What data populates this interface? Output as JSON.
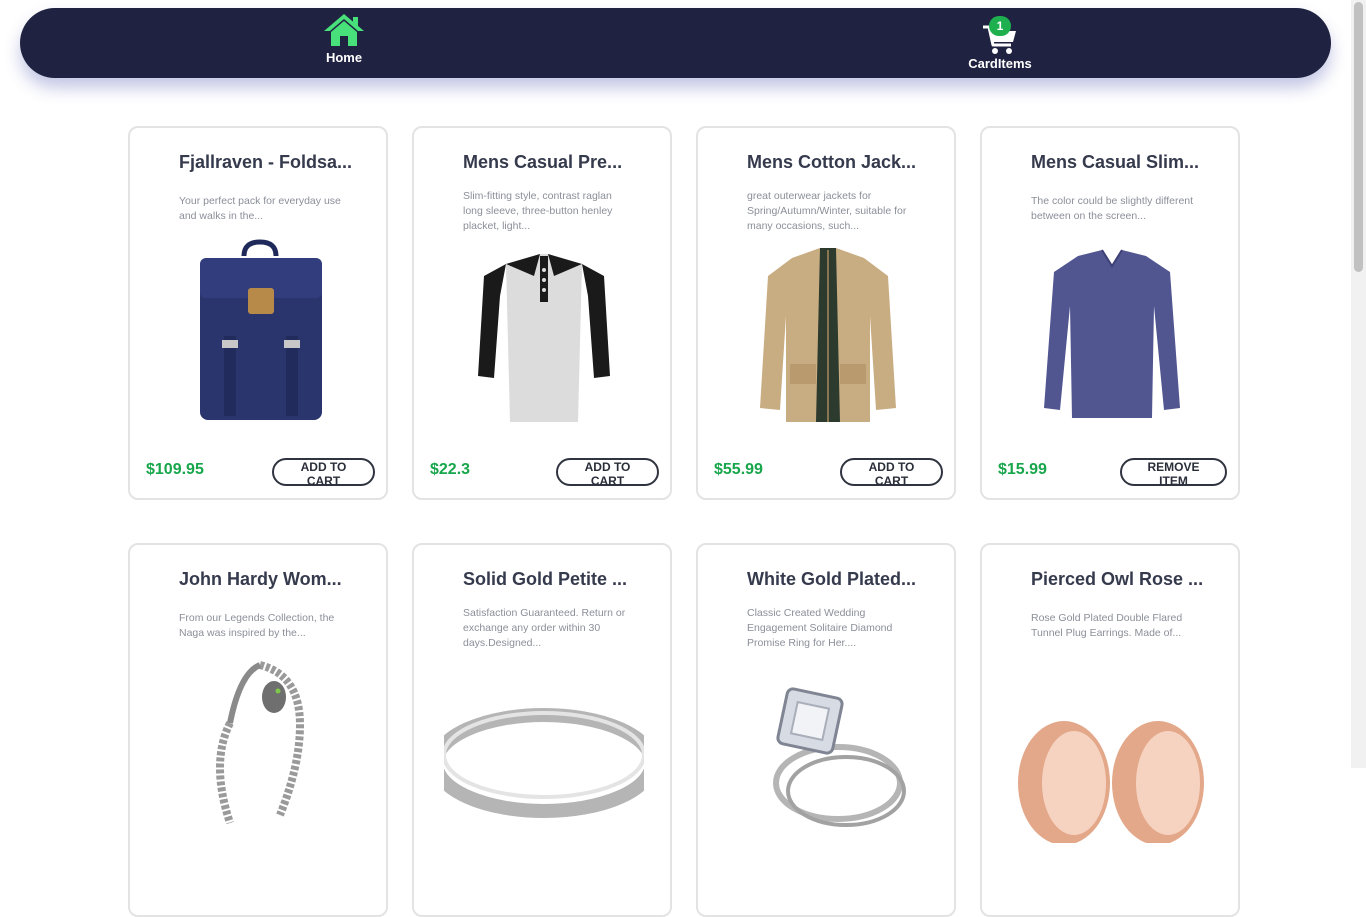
{
  "nav": {
    "home_label": "Home",
    "cart_label": "CardItems",
    "cart_count": "1"
  },
  "products": [
    {
      "title": "Fjallraven - Foldsa...",
      "desc": "Your perfect pack for everyday use and walks in the...",
      "price": "$109.95",
      "button": "ADD TO CART",
      "image": "backpack"
    },
    {
      "title": "Mens Casual Pre...",
      "desc": "Slim-fitting style, contrast raglan long sleeve, three-button henley placket, light...",
      "price": "$22.3",
      "button": "ADD TO CART",
      "image": "henley-shirt"
    },
    {
      "title": "Mens Cotton Jack...",
      "desc": "great outerwear jackets for Spring/Autumn/Winter, suitable for many occasions, such...",
      "price": "$55.99",
      "button": "ADD TO CART",
      "image": "cotton-jacket"
    },
    {
      "title": "Mens Casual Slim...",
      "desc": "The color could be slightly different between on the screen...",
      "price": "$15.99",
      "button": "REMOVE ITEM",
      "image": "slim-fit-shirt"
    },
    {
      "title": "John Hardy Wom...",
      "desc": "From our Legends Collection, the Naga was inspired by the...",
      "price": "",
      "button": "",
      "image": "dragon-bracelet"
    },
    {
      "title": "Solid Gold Petite ...",
      "desc": "Satisfaction Guaranteed. Return or exchange any order within 30 days.Designed...",
      "price": "",
      "button": "",
      "image": "silver-ring"
    },
    {
      "title": "White Gold Plated...",
      "desc": "Classic Created Wedding Engagement Solitaire Diamond Promise Ring for Her....",
      "price": "",
      "button": "",
      "image": "diamond-ring"
    },
    {
      "title": "Pierced Owl Rose ...",
      "desc": "Rose Gold Plated Double Flared Tunnel Plug Earrings. Made of...",
      "price": "",
      "button": "",
      "image": "rose-gold-plugs"
    }
  ],
  "colors": {
    "navbar": "#1f2240",
    "home_icon": "#47e07a",
    "price": "#18a64c",
    "badge": "#1eb04f"
  }
}
